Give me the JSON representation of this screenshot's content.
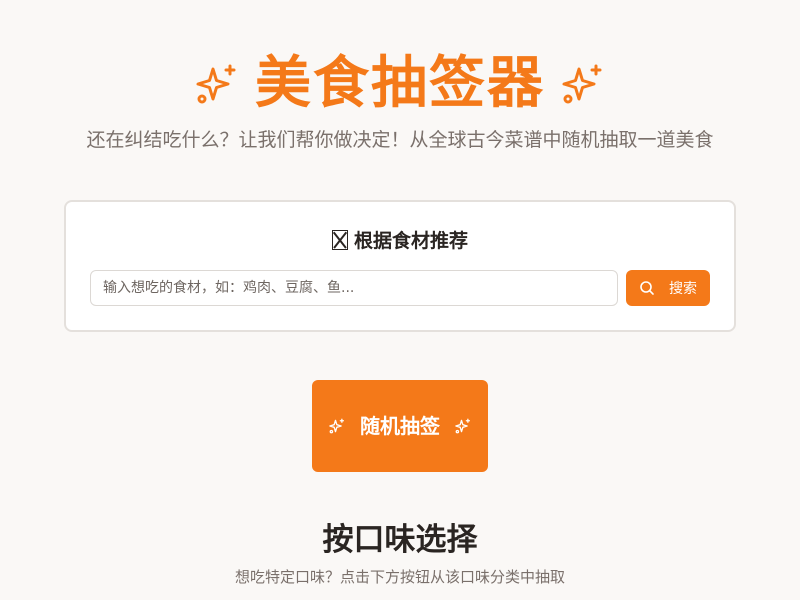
{
  "header": {
    "title": "美食抽签器",
    "subtitle": "还在纠结吃什么？让我们帮你做决定！从全球古今菜谱中随机抽取一道美食",
    "left_icon": "sparkles-icon",
    "right_icon": "sparkles-icon"
  },
  "search": {
    "title": "根据食材推荐",
    "title_icon": "missing-glyph-icon",
    "placeholder": "输入想吃的食材，如：鸡肉、豆腐、鱼...",
    "value": "",
    "button_label": "搜索",
    "button_icon": "search-icon"
  },
  "random": {
    "label": "随机抽签",
    "icon": "sparkles-icon"
  },
  "flavor": {
    "title": "按口味选择",
    "subtitle": "想吃特定口味？点击下方按钮从该口味分类中抽取"
  },
  "colors": {
    "accent": "#f47919",
    "background": "#faf8f6",
    "text": "#2a2522",
    "muted_text": "#7a706b"
  }
}
